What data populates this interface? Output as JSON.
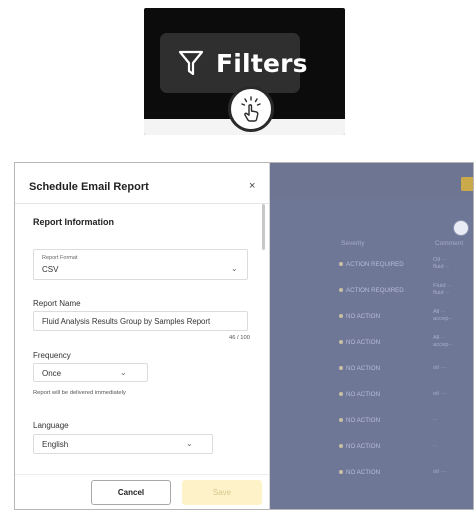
{
  "filters_inset": {
    "label": "Filters",
    "icon": "filter-icon",
    "cursor_icon": "tap-hand-icon"
  },
  "dialog": {
    "title": "Schedule Email Report",
    "close_icon": "×",
    "section_title": "Report Information",
    "report_format": {
      "caption": "Report Format",
      "value": "CSV"
    },
    "report_name": {
      "label": "Report Name",
      "value": "Fluid Analysis Results Group by Samples Report",
      "counter": "46 / 100"
    },
    "frequency": {
      "label": "Frequency",
      "value": "Once",
      "hint": "Report will be delivered immediately"
    },
    "language": {
      "label": "Language",
      "value": "English"
    },
    "footer": {
      "cancel_label": "Cancel",
      "save_label": "Save"
    }
  },
  "background_grid": {
    "headers": {
      "col1": "Severity",
      "col2": "Comment"
    },
    "rows": [
      {
        "severity": "ACTION REQUIRED"
      },
      {
        "severity": "ACTION REQUIRED"
      },
      {
        "severity": "NO ACTION"
      },
      {
        "severity": "NO ACTION"
      },
      {
        "severity": "NO ACTION"
      },
      {
        "severity": "NO ACTION"
      },
      {
        "severity": "NO ACTION"
      },
      {
        "severity": "NO ACTION"
      },
      {
        "severity": "NO ACTION"
      }
    ]
  },
  "colors": {
    "accent_disabled": "#fdf2c8",
    "overlay": "#6f7797",
    "dark_inset": "#0c0c0c"
  }
}
